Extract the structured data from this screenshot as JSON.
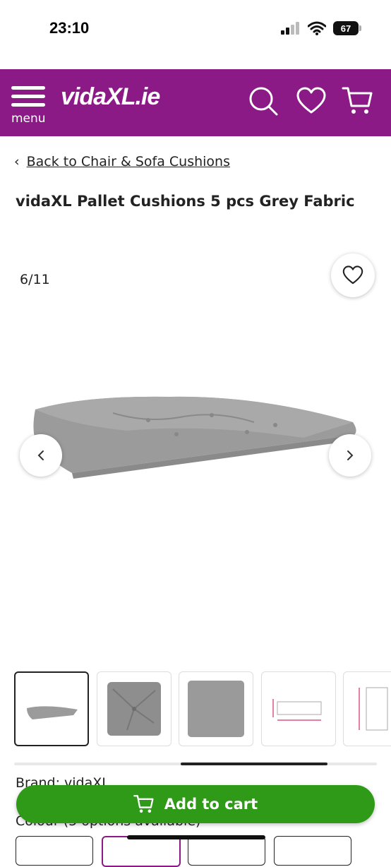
{
  "status": {
    "time": "23:10",
    "battery": "67"
  },
  "header": {
    "menu_label": "menu",
    "logo_text": "vidaXL.ie",
    "icons": [
      "search-icon",
      "heart-icon",
      "cart-icon"
    ]
  },
  "breadcrumb": {
    "label": "Back to Chair & Sofa Cushions"
  },
  "product": {
    "title": "vidaXL Pallet Cushions 5 pcs Grey Fabric",
    "image_counter": "6/11",
    "brand": "Brand: vidaXL",
    "colour": "Colour (5 options available)"
  },
  "cart": {
    "label": "Add to cart"
  },
  "colors": {
    "header": "#8b1a87",
    "cart_button": "#2e9a17",
    "cushion": "#9a9a9a"
  }
}
